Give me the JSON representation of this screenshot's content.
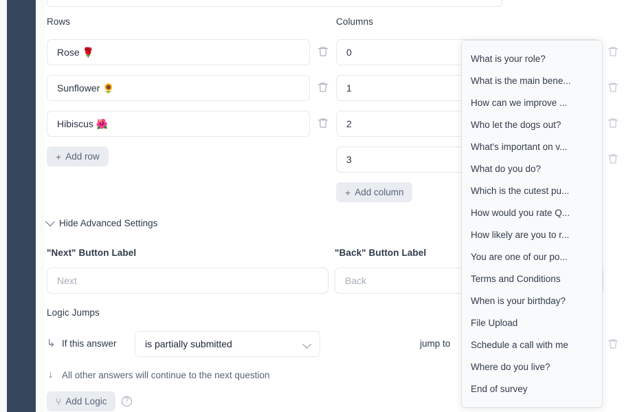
{
  "colors": {
    "sidebar": "#36465d",
    "pill_bg": "#e9edf2",
    "field_border": "#e4e7eb",
    "text": "#2f3a4a",
    "placeholder": "#a7aeb8",
    "dropdown_bg": "#f9fafb"
  },
  "rows_section": {
    "label": "Rows",
    "items": [
      {
        "value": "Rose 🌹"
      },
      {
        "value": "Sunflower 🌻"
      },
      {
        "value": "Hibiscus 🌺"
      }
    ],
    "add_label": "Add row",
    "plus": "+"
  },
  "columns_section": {
    "label": "Columns",
    "items": [
      {
        "value": "0"
      },
      {
        "value": "1"
      },
      {
        "value": "2"
      },
      {
        "value": "3"
      }
    ],
    "add_label": "Add column",
    "plus": "+"
  },
  "advanced": {
    "toggle_label": "Hide Advanced Settings",
    "next_button": {
      "label": "\"Next\" Button Label",
      "value": "",
      "placeholder": "Next"
    },
    "back_button": {
      "label": "\"Back\" Button Label",
      "value": "",
      "placeholder": "Back"
    }
  },
  "logic": {
    "heading": "Logic Jumps",
    "branch_arrow": "↳",
    "if_label": "If this answer",
    "condition_value": "is partially submitted",
    "jump_to_label": "jump to",
    "fallthrough_arrow": "↓",
    "fallthrough_text": "All other answers will continue to the next question",
    "add_logic_label": "Add Logic",
    "add_logic_icon": "⑂",
    "help_icon": "?"
  },
  "jump_dropdown": {
    "options": [
      "What is your role?",
      "What is the main bene...",
      "How can we improve ...",
      "Who let the dogs out?",
      "What's important on v...",
      "What do you do?",
      "Which is the cutest pu...",
      "How would you rate Q...",
      "How likely are you to r...",
      "You are one of our po...",
      "Terms and Conditions",
      "When is your birthday?",
      "File Upload",
      "Schedule a call with me",
      "Where do you live?",
      "End of survey"
    ]
  }
}
